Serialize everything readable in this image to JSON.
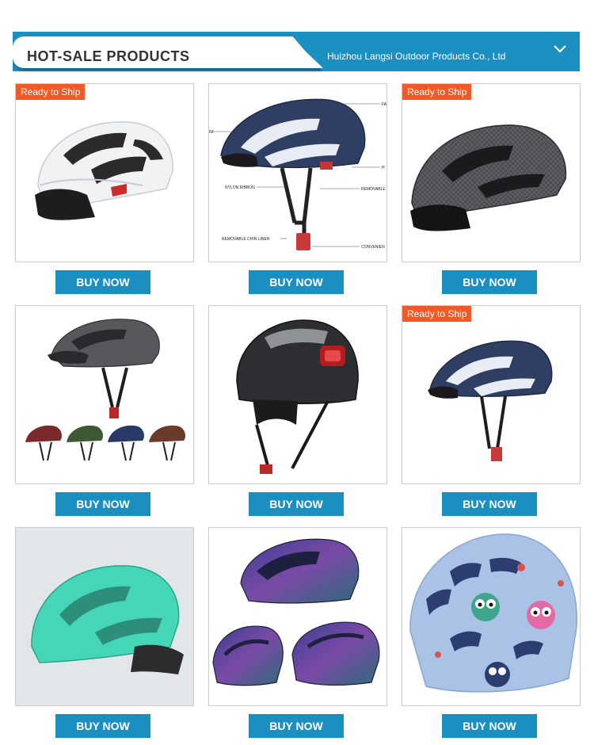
{
  "header": {
    "title": "HOT-SALE PRODUCTS",
    "company": "Huizhou Langsi Outdoor Products Co., Ltd",
    "chevron_icon": "chevron-down-icon"
  },
  "colors": {
    "accent": "#1a8fc0",
    "badge": "#f05a28"
  },
  "products": [
    {
      "badge": "Ready to Ship",
      "button": "BUY NOW",
      "image": "white-black-bike-helmet"
    },
    {
      "badge": "",
      "button": "BUY NOW",
      "image": "navy-helmet-parts-diagram",
      "diagram_labels": [
        "FA",
        "IM",
        "H",
        "NYLON RIBBON",
        "REMOVABLE",
        "REMOVABLE CHIN LINER",
        "CONVENIEN"
      ]
    },
    {
      "badge": "Ready to Ship",
      "button": "BUY NOW",
      "image": "carbon-grey-bike-helmet"
    },
    {
      "badge": "",
      "button": "BUY NOW",
      "image": "dark-grey-helmet-with-color-variants"
    },
    {
      "badge": "",
      "button": "BUY NOW",
      "image": "black-helmet-with-red-rear-light"
    },
    {
      "badge": "Ready to Ship",
      "button": "BUY NOW",
      "image": "navy-white-bike-helmet"
    },
    {
      "badge": "",
      "button": "BUY NOW",
      "image": "mint-green-bike-helmet"
    },
    {
      "badge": "",
      "button": "BUY NOW",
      "image": "chameleon-purple-helmets"
    },
    {
      "badge": "",
      "button": "BUY NOW",
      "image": "kids-owl-print-helmet"
    }
  ]
}
